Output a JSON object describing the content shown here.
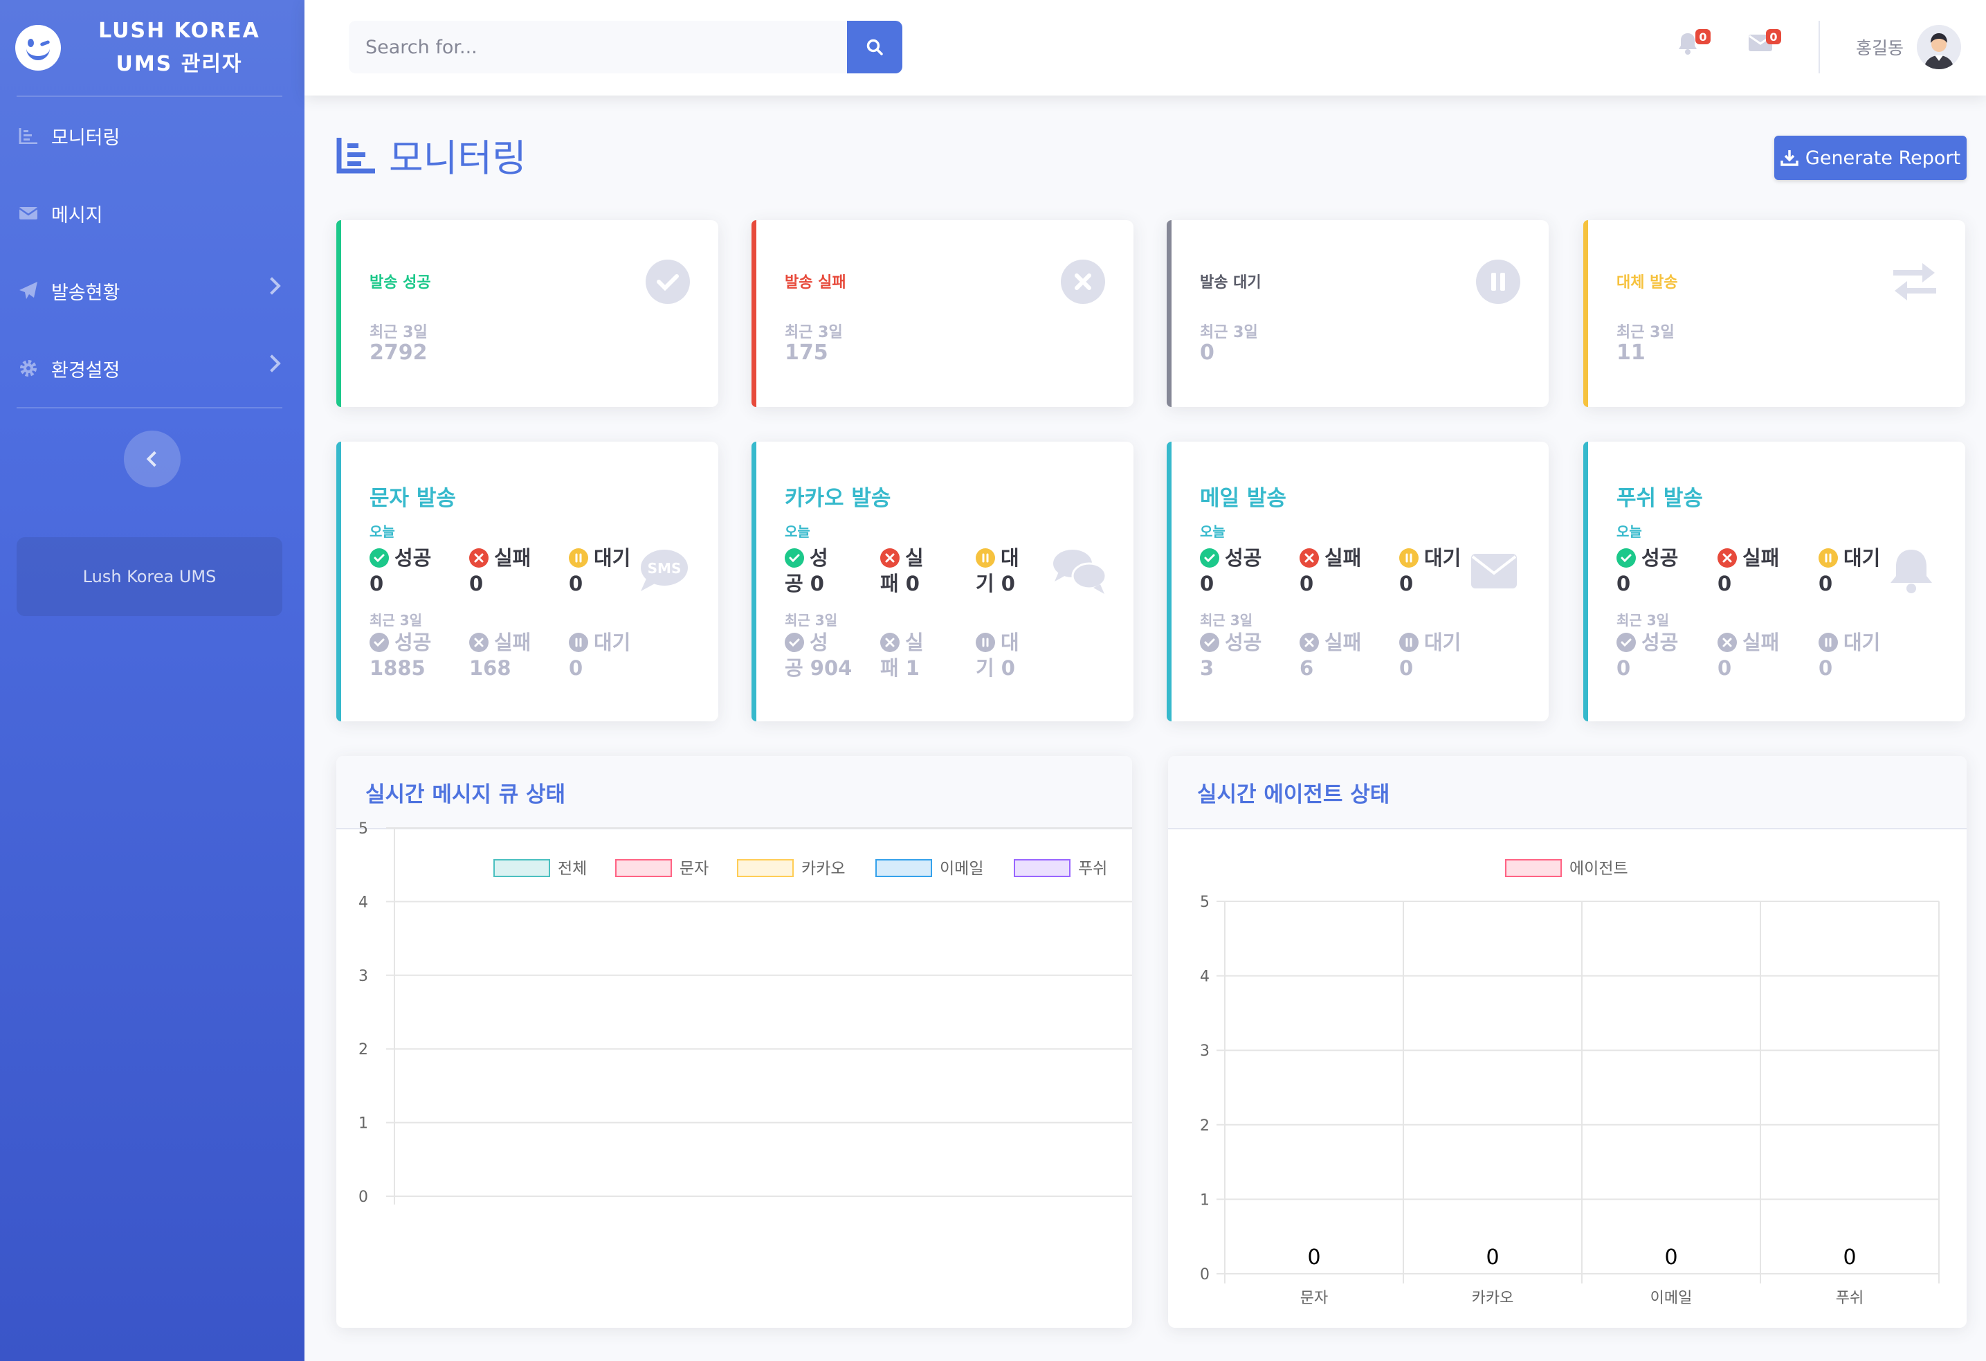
{
  "brand": {
    "line1": "LUSH KOREA",
    "line2": "UMS 관리자"
  },
  "sidebar": {
    "items": [
      {
        "label": "모니터링",
        "icon": "chart-icon"
      },
      {
        "label": "메시지",
        "icon": "envelope-icon"
      },
      {
        "label": "발송현황",
        "icon": "paper-plane-icon"
      },
      {
        "label": "환경설정",
        "icon": "cog-icon"
      }
    ],
    "card_text": "Lush Korea UMS"
  },
  "topbar": {
    "search_placeholder": "Search for...",
    "alerts_count": "0",
    "messages_count": "0",
    "user_name": "홍길동"
  },
  "page": {
    "title": "모니터링",
    "report_button": "Generate Report"
  },
  "stats": [
    {
      "title": "발송 성공",
      "sub": "최근 3일",
      "value": "2792",
      "color": "#1cc88a",
      "icon": "check-circle-icon"
    },
    {
      "title": "발송 실패",
      "sub": "최근 3일",
      "value": "175",
      "color": "#e74a3b",
      "icon": "times-circle-icon"
    },
    {
      "title": "발송 대기",
      "sub": "최근 3일",
      "value": "0",
      "color": "#5a5c69",
      "icon": "pause-circle-icon"
    },
    {
      "title": "대체 발송",
      "sub": "최근 3일",
      "value": "11",
      "color": "#f6c23e",
      "icon": "exchange-icon"
    }
  ],
  "channels": [
    {
      "title": "문자 발송",
      "today_label": "오늘",
      "recent_label": "최근 3일",
      "icon": "sms-icon",
      "today": {
        "success": "성공",
        "success_val": "0",
        "fail": "실패",
        "fail_val": "0",
        "wait": "대기",
        "wait_val": "0"
      },
      "recent": {
        "success": "성공",
        "success_val": "1885",
        "fail": "실패",
        "fail_val": "168",
        "wait": "대기",
        "wait_val": "0"
      }
    },
    {
      "title": "카카오 발송",
      "today_label": "오늘",
      "recent_label": "최근 3일",
      "icon": "comments-icon",
      "today": {
        "success": "성",
        "success_val": "공 0",
        "fail": "실",
        "fail_val": "패 0",
        "wait": "대",
        "wait_val": "기 0"
      },
      "recent": {
        "success": "성",
        "success_val": "공 904",
        "fail": "실",
        "fail_val": "패 1",
        "wait": "대",
        "wait_val": "기 0"
      }
    },
    {
      "title": "메일 발송",
      "today_label": "오늘",
      "recent_label": "최근 3일",
      "icon": "envelope-icon",
      "today": {
        "success": "성공",
        "success_val": "0",
        "fail": "실패",
        "fail_val": "0",
        "wait": "대기",
        "wait_val": "0"
      },
      "recent": {
        "success": "성공",
        "success_val": "3",
        "fail": "실패",
        "fail_val": "6",
        "wait": "대기",
        "wait_val": "0"
      }
    },
    {
      "title": "푸쉬 발송",
      "today_label": "오늘",
      "recent_label": "최근 3일",
      "icon": "bell-icon",
      "today": {
        "success": "성공",
        "success_val": "0",
        "fail": "실패",
        "fail_val": "0",
        "wait": "대기",
        "wait_val": "0"
      },
      "recent": {
        "success": "성공",
        "success_val": "0",
        "fail": "실패",
        "fail_val": "0",
        "wait": "대기",
        "wait_val": "0"
      }
    }
  ],
  "colors": {
    "success": "#1cc88a",
    "fail": "#e74a3b",
    "wait": "#f6c23e",
    "muted": "#b7b9cc",
    "primary": "#4e73df",
    "info": "#36b9cc"
  },
  "chart_data": [
    {
      "type": "line",
      "title": "실시간 메시지 큐 상태",
      "series": [
        {
          "name": "전체",
          "values": [],
          "color": "#4bc0c0"
        },
        {
          "name": "문자",
          "values": [],
          "color": "#ff6384"
        },
        {
          "name": "카카오",
          "values": [],
          "color": "#ffcd56"
        },
        {
          "name": "이메일",
          "values": [],
          "color": "#36a2eb"
        },
        {
          "name": "푸쉬",
          "values": [],
          "color": "#9966ff"
        }
      ],
      "ylim": [
        0,
        5
      ],
      "yticks": [
        0,
        1,
        2,
        3,
        4,
        5
      ],
      "legend": "top",
      "grid": true
    },
    {
      "type": "bar",
      "title": "실시간 에이전트 상태",
      "categories": [
        "문자",
        "카카오",
        "이메일",
        "푸쉬"
      ],
      "series": [
        {
          "name": "에이전트",
          "values": [
            0,
            0,
            0,
            0
          ],
          "color": "#ff6384"
        }
      ],
      "data_labels": [
        "0",
        "0",
        "0",
        "0"
      ],
      "ylim": [
        0,
        5
      ],
      "yticks": [
        0,
        1,
        2,
        3,
        4,
        5
      ],
      "legend": "top",
      "grid": true
    }
  ]
}
